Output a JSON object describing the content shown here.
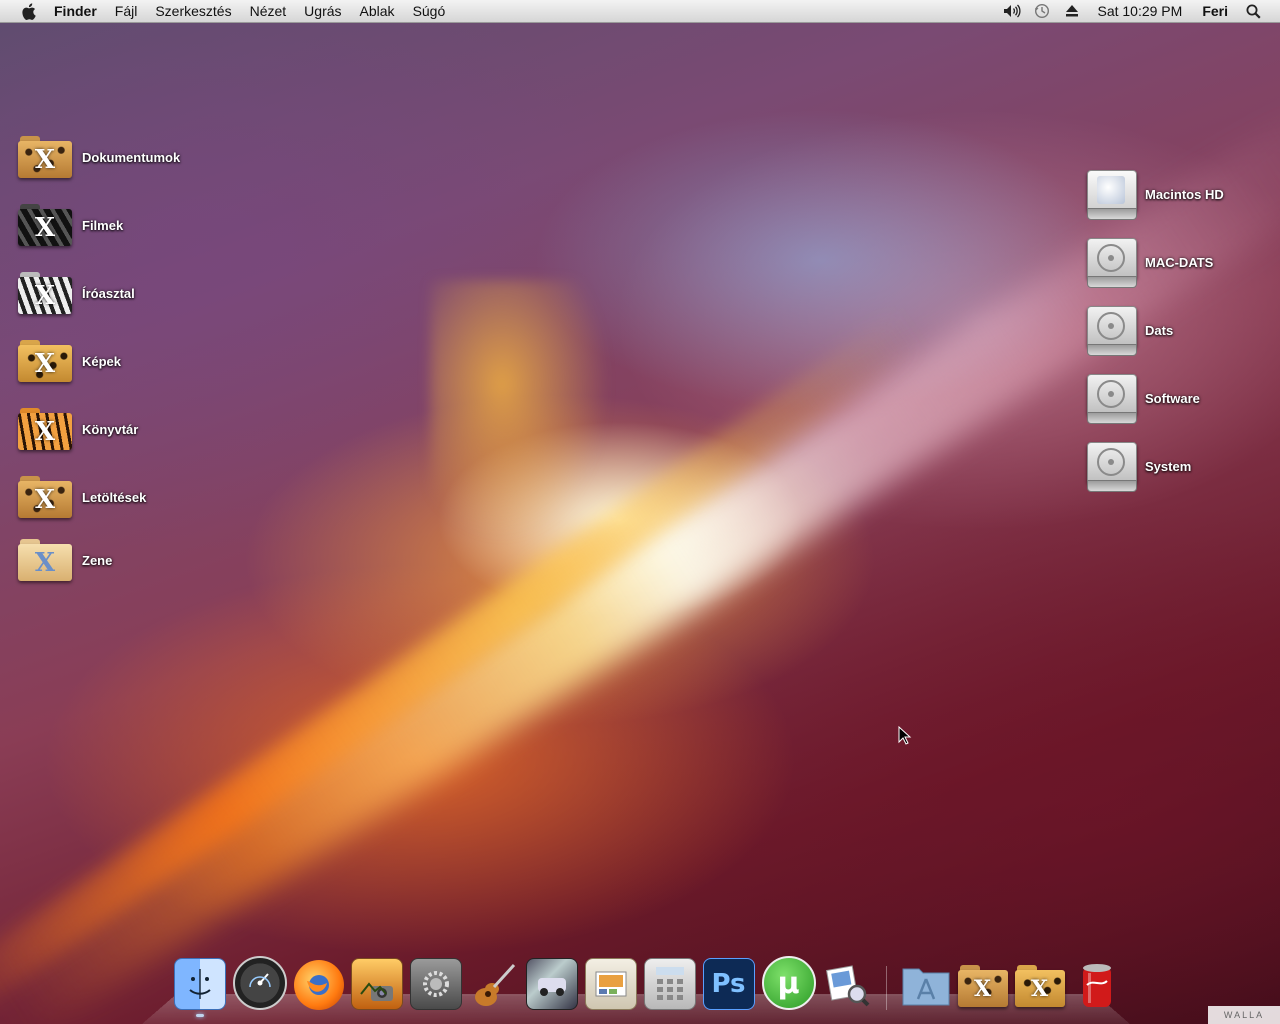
{
  "menubar": {
    "app_name": "Finder",
    "menus": [
      "Fájl",
      "Szerkesztés",
      "Nézet",
      "Ugrás",
      "Ablak",
      "Súgó"
    ],
    "status_icons": [
      "volume-icon",
      "time-machine-icon",
      "eject-icon"
    ],
    "clock": "Sat 10:29 PM",
    "user": "Feri",
    "spotlight_icon": "spotlight-search-icon"
  },
  "desktop": {
    "left_folders": [
      {
        "label": "Dokumentumok",
        "icon": "leopard-folder-icon"
      },
      {
        "label": "Filmek",
        "icon": "zebra-folder-icon"
      },
      {
        "label": "Íróasztal",
        "icon": "zebra-folder-icon"
      },
      {
        "label": "Képek",
        "icon": "leopard-folder-icon"
      },
      {
        "label": "Könyvtár",
        "icon": "tiger-folder-icon"
      },
      {
        "label": "Letöltések",
        "icon": "leopard-folder-icon"
      },
      {
        "label": "Zene",
        "icon": "plain-folder-icon"
      }
    ],
    "right_drives": [
      {
        "label": "Macintos HD",
        "icon": "system-drive-icon"
      },
      {
        "label": "MAC-DATS",
        "icon": "hard-drive-icon"
      },
      {
        "label": "Dats",
        "icon": "hard-drive-icon"
      },
      {
        "label": "Software",
        "icon": "hard-drive-icon"
      },
      {
        "label": "System",
        "icon": "hard-drive-icon"
      }
    ]
  },
  "dock": {
    "apps": [
      {
        "name": "finder-icon",
        "running": true
      },
      {
        "name": "dashboard-icon",
        "running": false
      },
      {
        "name": "firefox-icon",
        "running": false
      },
      {
        "name": "iphoto-icon",
        "running": false
      },
      {
        "name": "system-preferences-icon",
        "running": false
      },
      {
        "name": "garageband-icon",
        "running": false
      },
      {
        "name": "screenshot-app-icon",
        "running": false
      },
      {
        "name": "photo-browser-icon",
        "running": false
      },
      {
        "name": "calculator-icon",
        "running": false
      },
      {
        "name": "photoshop-icon",
        "running": false
      },
      {
        "name": "utorrent-icon",
        "running": false
      },
      {
        "name": "preview-icon",
        "running": false
      }
    ],
    "stacks": [
      {
        "name": "applications-stack-icon"
      },
      {
        "name": "documents-stack-icon"
      },
      {
        "name": "downloads-stack-icon"
      },
      {
        "name": "trash-can-icon"
      }
    ],
    "photoshop_label": "Ps",
    "utorrent_label": "µ"
  },
  "watermark": "WALLA"
}
